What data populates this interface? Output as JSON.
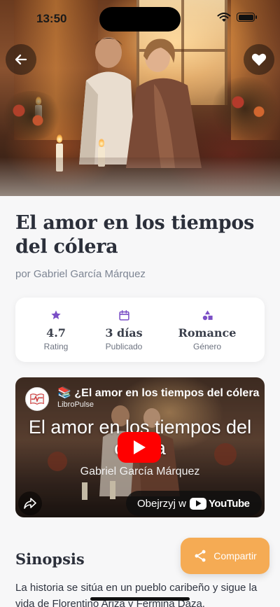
{
  "status_bar": {
    "time": "13:50"
  },
  "hero": {
    "image_subject": "romantic-couple-candlelight"
  },
  "nav": {
    "back_icon": "arrow-left-icon",
    "favorite_icon": "heart-icon"
  },
  "book": {
    "title": "El amor en los tiempos del cólera",
    "author": "por Gabriel García Márquez"
  },
  "stats": [
    {
      "icon": "star-icon",
      "value": "4.7",
      "label": "Rating"
    },
    {
      "icon": "calendar-icon",
      "value": "3 días",
      "label": "Publicado"
    },
    {
      "icon": "shapes-icon",
      "value": "Romance",
      "label": "Género"
    }
  ],
  "video": {
    "title": "📚 ¿El amor en los tiempos del cólera",
    "channel": "LibroPulse",
    "overlay_title": "El amor en los tiempos del cólera",
    "overlay_author": "Gabriel García Márquez",
    "watch_label": "Obejrzyj w",
    "youtube_word": "YouTube"
  },
  "sections": {
    "synopsis_heading": "Sinopsis"
  },
  "synopsis": "La historia se sitúa en un pueblo caribeño y sigue la vida de Florentino Ariza y Fermina Daza.",
  "share_button": {
    "label": "Compartir",
    "color": "#f5ab54"
  },
  "colors": {
    "accent": "#7b4fc6",
    "youtube_red": "#ff0000"
  }
}
